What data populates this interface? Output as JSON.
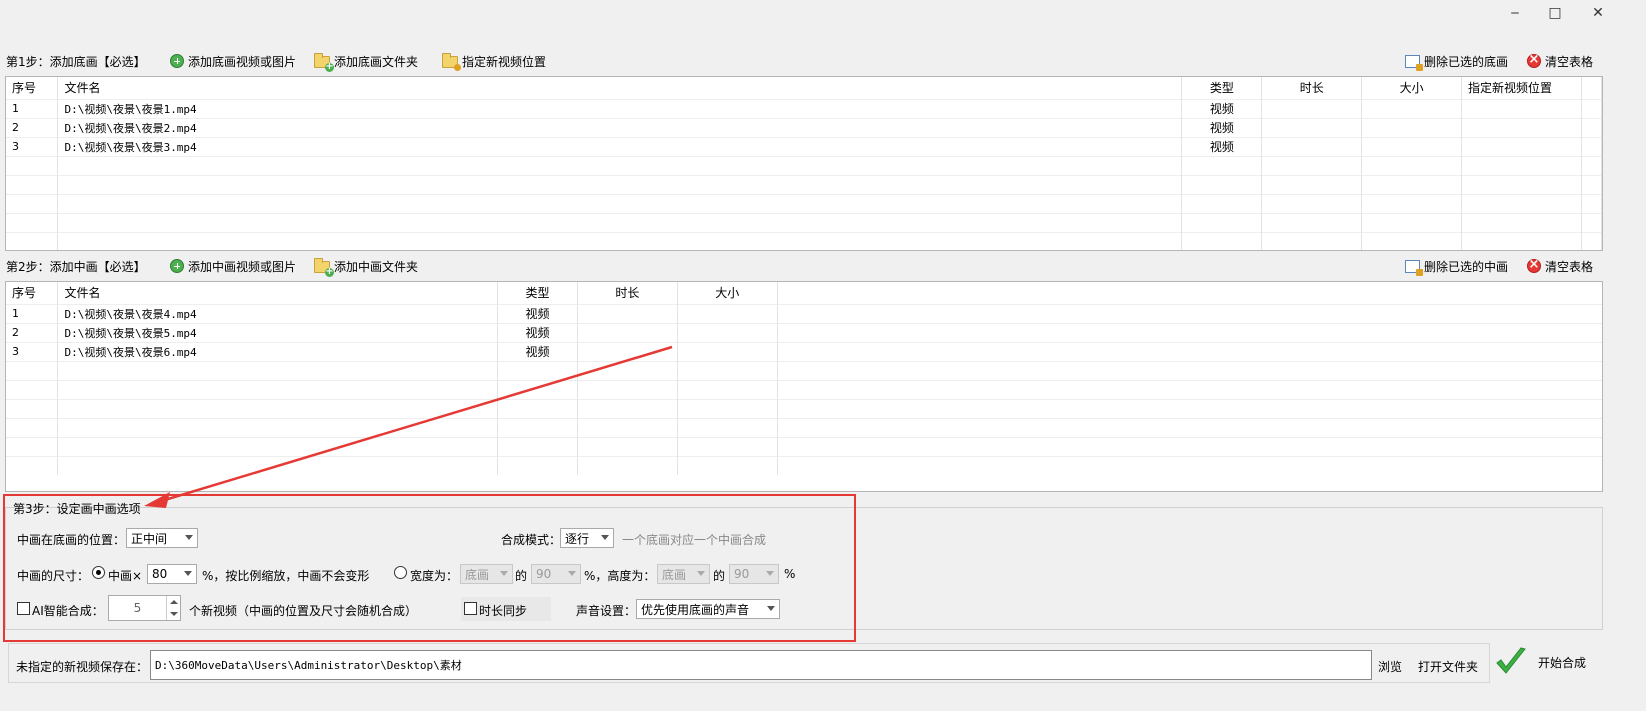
{
  "window": {
    "minimize": "‒",
    "maximize": "□",
    "close": "✕"
  },
  "step1": {
    "label": "第1步：添加底画【必选】",
    "add_video_image": "添加底画视频或图片",
    "add_folder": "添加底画文件夹",
    "set_location": "指定新视频位置",
    "delete_selected": "删除已选的底画",
    "clear_table": "清空表格",
    "columns": [
      "序号",
      "文件名",
      "类型",
      "时长",
      "大小",
      "指定新视频位置"
    ],
    "rows": [
      {
        "index": "1",
        "file": "D:\\视频\\夜景\\夜景1.mp4",
        "type": "视频",
        "duration": "",
        "size": "",
        "location": ""
      },
      {
        "index": "2",
        "file": "D:\\视频\\夜景\\夜景2.mp4",
        "type": "视频",
        "duration": "",
        "size": "",
        "location": ""
      },
      {
        "index": "3",
        "file": "D:\\视频\\夜景\\夜景3.mp4",
        "type": "视频",
        "duration": "",
        "size": "",
        "location": ""
      }
    ]
  },
  "step2": {
    "label": "第2步：添加中画【必选】",
    "add_video_image": "添加中画视频或图片",
    "add_folder": "添加中画文件夹",
    "delete_selected": "删除已选的中画",
    "clear_table": "清空表格",
    "columns": [
      "序号",
      "文件名",
      "类型",
      "时长",
      "大小"
    ],
    "rows": [
      {
        "index": "1",
        "file": "D:\\视频\\夜景\\夜景4.mp4",
        "type": "视频",
        "duration": "",
        "size": ""
      },
      {
        "index": "2",
        "file": "D:\\视频\\夜景\\夜景5.mp4",
        "type": "视频",
        "duration": "",
        "size": ""
      },
      {
        "index": "3",
        "file": "D:\\视频\\夜景\\夜景6.mp4",
        "type": "视频",
        "duration": "",
        "size": ""
      }
    ]
  },
  "step3": {
    "label": "第3步：设定画中画选项",
    "position_label": "中画在底画的位置：",
    "position_value": "正中间",
    "mode_label": "合成模式：",
    "mode_value": "逐行",
    "mode_hint": "一个底画对应一个中画合成",
    "size_label": "中画的尺寸：",
    "scale_label": "中画×",
    "scale_value": "80",
    "scale_suffix": "%，按比例缩放，中画不会变形",
    "width_label": "宽度为：",
    "width_ref": "底画",
    "of1": "的",
    "width_value": "90",
    "height_label": "%，高度为：",
    "height_ref": "底画",
    "of2": "的",
    "height_value": "90",
    "pct": "%",
    "ai_label": "AI智能合成：",
    "ai_count": "5",
    "ai_suffix": "个新视频（中画的位置及尺寸会随机合成）",
    "sync_label": "时长同步",
    "audio_label": "声音设置：",
    "audio_value": "优先使用底画的声音"
  },
  "output": {
    "label": "未指定的新视频保存在：",
    "path": "D:\\360MoveData\\Users\\Administrator\\Desktop\\素材",
    "browse": "浏览",
    "open_folder": "打开文件夹",
    "start": "开始合成"
  },
  "colors": {
    "highlight": "#e53935",
    "start_check": "#3cb043"
  }
}
